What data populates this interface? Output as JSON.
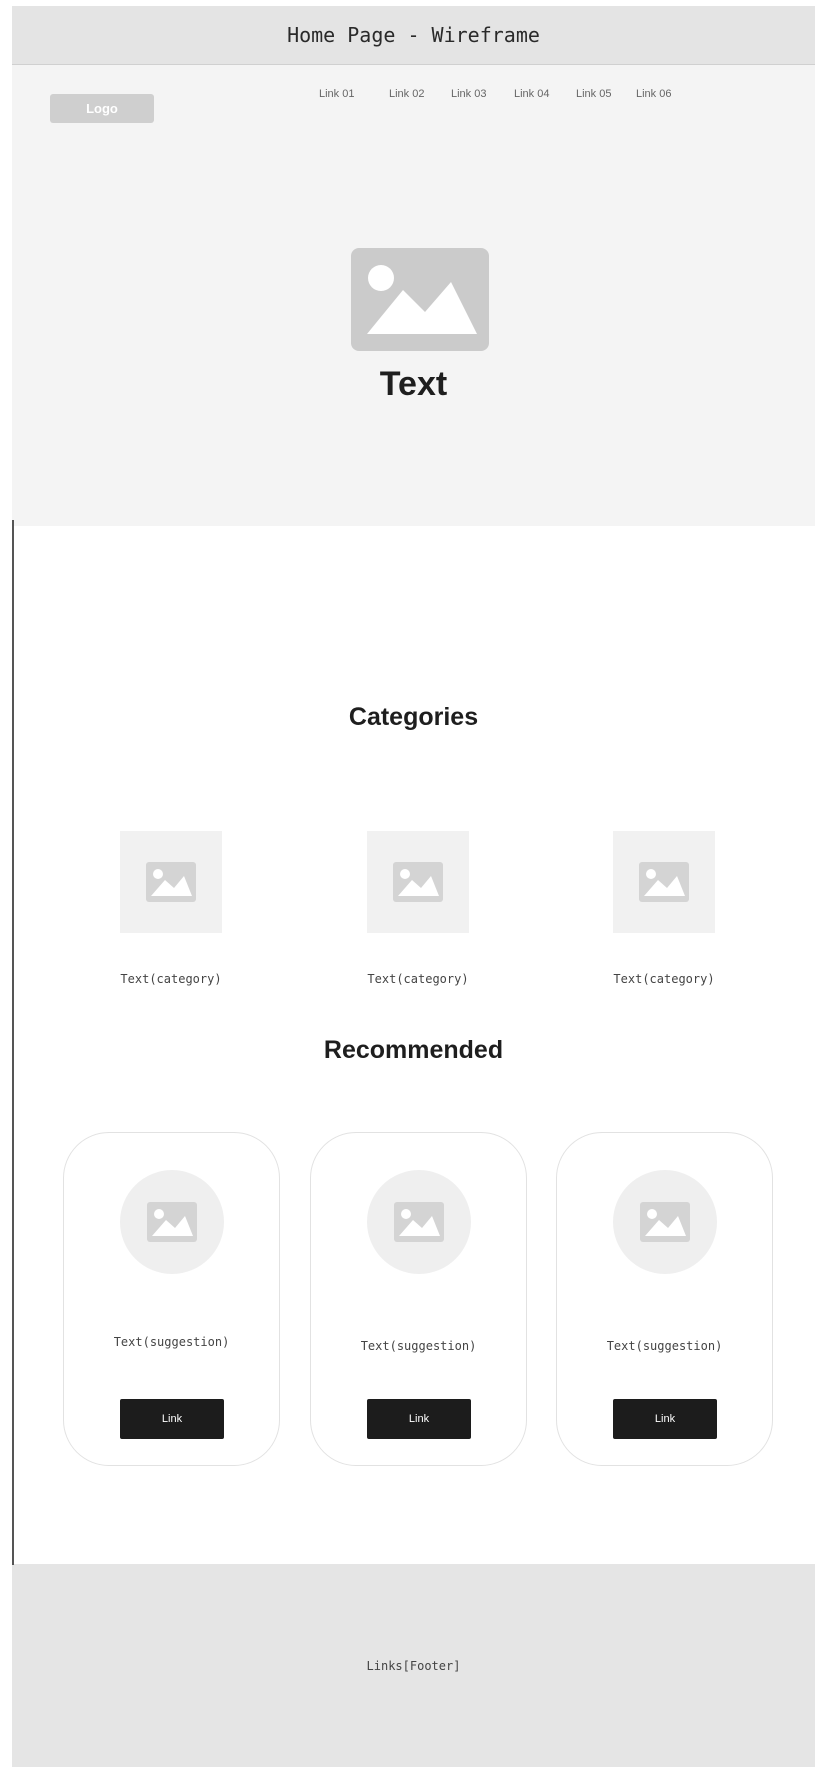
{
  "title_bar": {
    "title": "Home Page - Wireframe"
  },
  "header": {
    "logo": "Logo",
    "nav_links": [
      "Link 01",
      "Link 02",
      "Link 03",
      "Link 04",
      "Link 05",
      "Link 06"
    ]
  },
  "hero": {
    "image_icon": "image-placeholder-icon",
    "text": "Text"
  },
  "categories": {
    "title": "Categories",
    "items": [
      {
        "label": "Text(category)",
        "icon": "image-placeholder-icon"
      },
      {
        "label": "Text(category)",
        "icon": "image-placeholder-icon"
      },
      {
        "label": "Text(category)",
        "icon": "image-placeholder-icon"
      }
    ]
  },
  "recommended": {
    "title": "Recommended",
    "cards": [
      {
        "label": "Text(suggestion)",
        "button": "Link",
        "icon": "image-placeholder-icon"
      },
      {
        "label": "Text(suggestion)",
        "button": "Link",
        "icon": "image-placeholder-icon"
      },
      {
        "label": "Text(suggestion)",
        "button": "Link",
        "icon": "image-placeholder-icon"
      }
    ]
  },
  "footer": {
    "text": "Links[Footer]"
  },
  "colors": {
    "title_bar_bg": "#e4e4e4",
    "hero_bg": "#f4f4f4",
    "placeholder": "#cbcbcb",
    "button_bg": "#1c1c1c",
    "footer_bg": "#e5e5e5"
  }
}
